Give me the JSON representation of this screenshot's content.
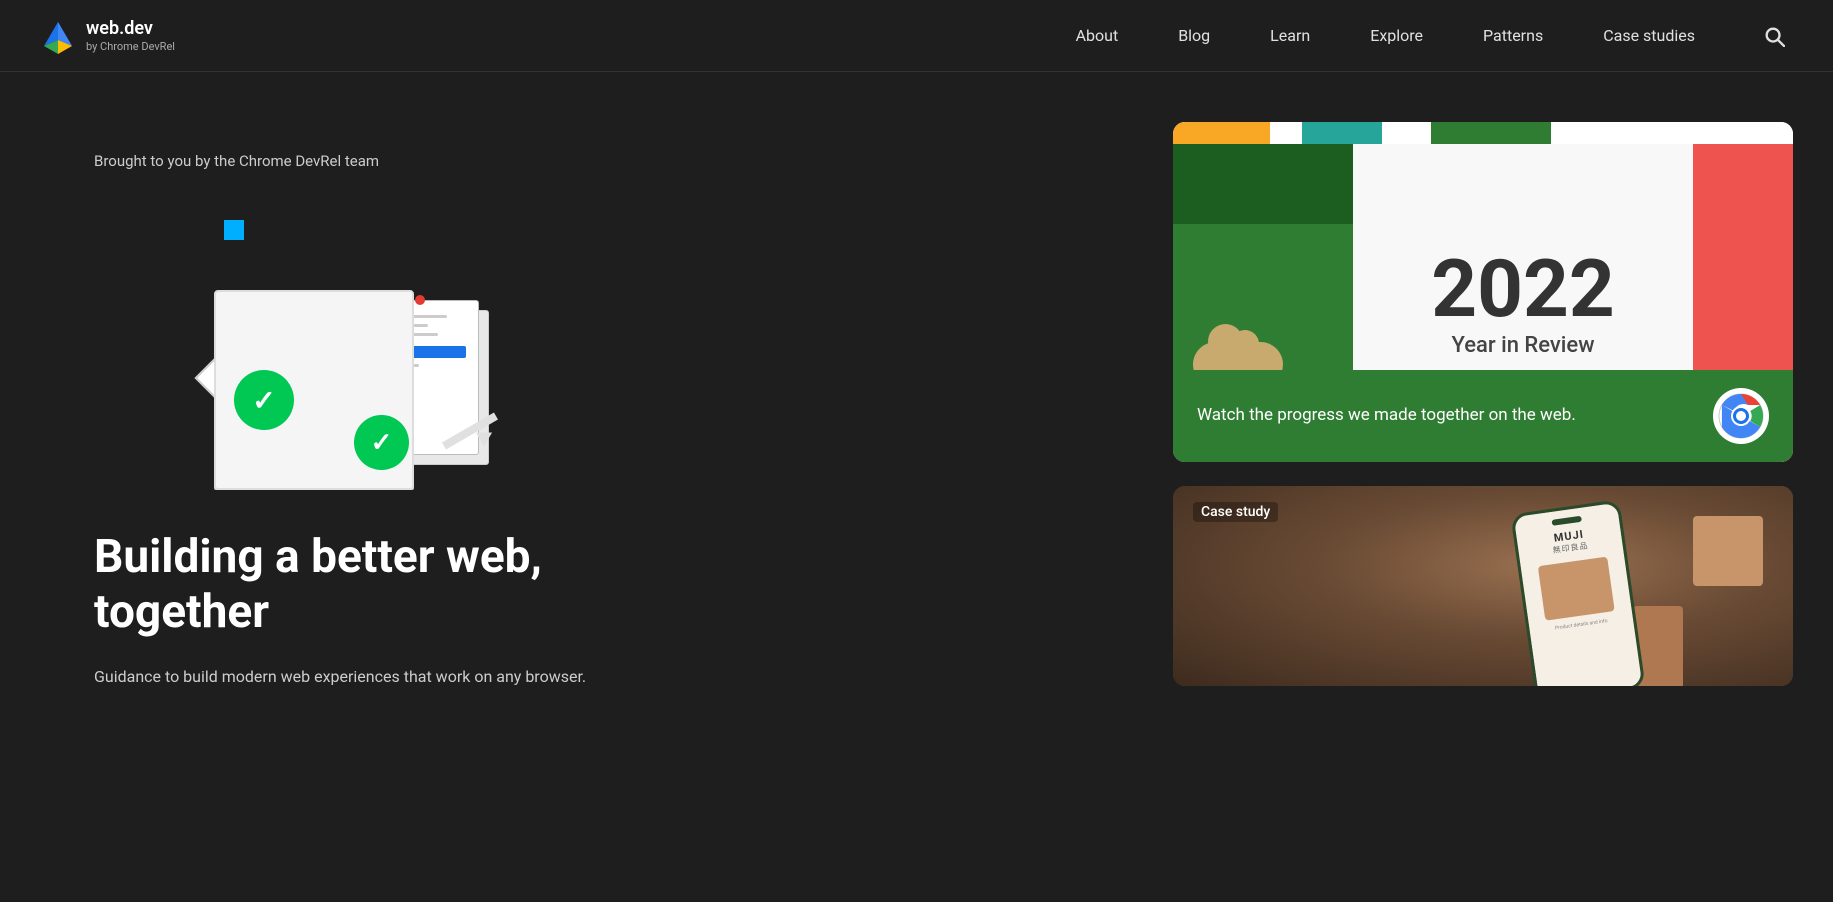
{
  "site": {
    "logo_title": "web.dev",
    "logo_subtitle": "by Chrome DevRel",
    "search_label": "Search"
  },
  "nav": {
    "items": [
      {
        "id": "about",
        "label": "About"
      },
      {
        "id": "blog",
        "label": "Blog"
      },
      {
        "id": "learn",
        "label": "Learn"
      },
      {
        "id": "explore",
        "label": "Explore"
      },
      {
        "id": "patterns",
        "label": "Patterns"
      },
      {
        "id": "case-studies",
        "label": "Case studies"
      }
    ]
  },
  "hero": {
    "tagline": "Brought to you by the Chrome DevRel team",
    "headline_line1": "Building a better web,",
    "headline_line2": "together",
    "description": "Guidance to build modern web experiences that work on any browser."
  },
  "cards": {
    "year_review": {
      "year": "2022",
      "subtitle": "Year in Review",
      "body_text": "Watch the progress we made together on the web.",
      "alt": "2022 Year in Review - Watch the progress we made together on the web"
    },
    "case_study": {
      "label": "Case study",
      "alt": "Case study - MUJI app on phone"
    }
  }
}
